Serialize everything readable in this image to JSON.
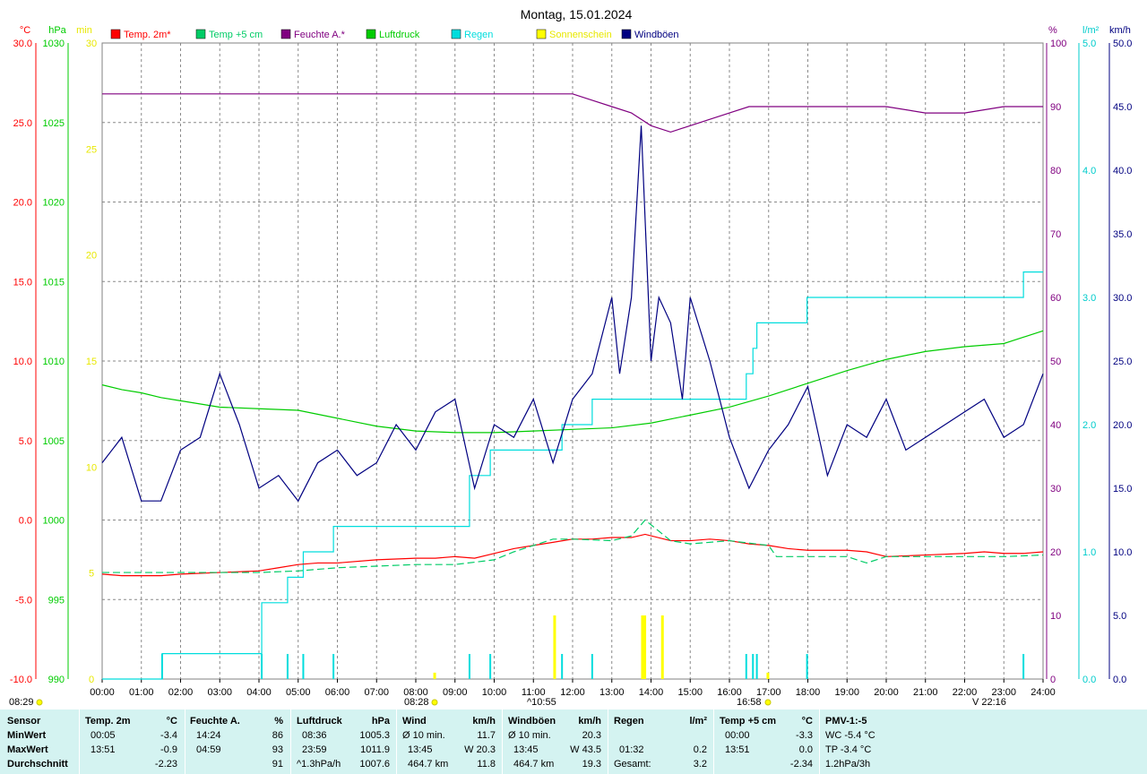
{
  "chart_data": {
    "type": "line",
    "title": "Montag, 15.01.2024",
    "x_ticks": [
      "00:00",
      "01:00",
      "02:00",
      "03:00",
      "04:00",
      "05:00",
      "06:00",
      "07:00",
      "08:00",
      "09:00",
      "10:00",
      "11:00",
      "12:00",
      "13:00",
      "14:00",
      "15:00",
      "16:00",
      "17:00",
      "18:00",
      "19:00",
      "20:00",
      "21:00",
      "22:00",
      "23:00",
      "24:00"
    ],
    "xlim": [
      0,
      24
    ],
    "grid": true,
    "legend_position": "top",
    "axes": {
      "temp": {
        "unit": "°C",
        "range": [
          -10,
          30
        ],
        "ticks": [
          "-10.0",
          "-5.0",
          "0.0",
          "5.0",
          "10.0",
          "15.0",
          "20.0",
          "25.0",
          "30.0"
        ],
        "color": "#ff0000"
      },
      "pressure": {
        "unit": "hPa",
        "range": [
          990,
          1030
        ],
        "ticks": [
          "990",
          "995",
          "1000",
          "1005",
          "1010",
          "1015",
          "1020",
          "1025",
          "1030"
        ],
        "color": "#00cc00"
      },
      "sunshine": {
        "unit": "min",
        "range": [
          0,
          30
        ],
        "ticks": [
          "0",
          "5",
          "10",
          "15",
          "20",
          "25",
          "30"
        ],
        "color": "#e8e800"
      },
      "humidity": {
        "unit": "%",
        "range": [
          0,
          100
        ],
        "ticks": [
          "0",
          "10",
          "20",
          "30",
          "40",
          "50",
          "60",
          "70",
          "80",
          "90",
          "100"
        ],
        "color": "#800080"
      },
      "rain": {
        "unit": "l/m²",
        "range": [
          0,
          5
        ],
        "ticks": [
          "0.0",
          "1.0",
          "2.0",
          "3.0",
          "4.0",
          "5.0"
        ],
        "color": "#00cccc"
      },
      "wind": {
        "unit": "km/h",
        "range": [
          0,
          50
        ],
        "ticks": [
          "0.0",
          "5.0",
          "10.0",
          "15.0",
          "20.0",
          "25.0",
          "30.0",
          "35.0",
          "40.0",
          "45.0",
          "50.0"
        ],
        "color": "#000080"
      }
    },
    "series": [
      {
        "name": "Temp. 2m*",
        "color": "#ff0000",
        "axis": "temp",
        "x": [
          0,
          0.5,
          1,
          1.5,
          2,
          3,
          4,
          4.5,
          5,
          5.5,
          6,
          7,
          8,
          8.5,
          9,
          9.5,
          10,
          10.5,
          11,
          11.5,
          12,
          12.5,
          13,
          13.5,
          13.85,
          14.5,
          15,
          15.5,
          16,
          16.5,
          17,
          17.5,
          18,
          19,
          19.5,
          20,
          21,
          22,
          22.5,
          23,
          23.5,
          24
        ],
        "y": [
          -3.4,
          -3.5,
          -3.5,
          -3.5,
          -3.4,
          -3.3,
          -3.2,
          -3.0,
          -2.8,
          -2.7,
          -2.7,
          -2.5,
          -2.4,
          -2.4,
          -2.3,
          -2.4,
          -2.1,
          -1.8,
          -1.6,
          -1.4,
          -1.2,
          -1.2,
          -1.1,
          -1.1,
          -0.9,
          -1.3,
          -1.3,
          -1.2,
          -1.3,
          -1.5,
          -1.6,
          -1.8,
          -1.9,
          -1.9,
          -2.0,
          -2.3,
          -2.2,
          -2.1,
          -2.0,
          -2.1,
          -2.1,
          -2.0
        ]
      },
      {
        "name": "Temp +5 cm",
        "color": "#00cc66",
        "dashed": true,
        "axis": "temp",
        "x": [
          0,
          2,
          4,
          5,
          6,
          7,
          8,
          9,
          10,
          10.5,
          11,
          11.5,
          12,
          13,
          13.5,
          13.85,
          14.5,
          15,
          16,
          17,
          17.2,
          18,
          19,
          19.5,
          20,
          21,
          22,
          23,
          24
        ],
        "y": [
          -3.3,
          -3.3,
          -3.3,
          -3.2,
          -3.0,
          -2.9,
          -2.8,
          -2.8,
          -2.5,
          -2.0,
          -1.6,
          -1.2,
          -1.2,
          -1.3,
          -1.0,
          0.0,
          -1.3,
          -1.5,
          -1.3,
          -1.6,
          -2.3,
          -2.3,
          -2.3,
          -2.7,
          -2.3,
          -2.3,
          -2.3,
          -2.3,
          -2.2
        ]
      },
      {
        "name": "Feuchte A.*",
        "color": "#800080",
        "axis": "humidity",
        "x": [
          0,
          1,
          2,
          3,
          4,
          5,
          6,
          7,
          8,
          9,
          10,
          11,
          12,
          12.5,
          13,
          13.5,
          14,
          14.5,
          15,
          15.5,
          16,
          16.5,
          17,
          18,
          19,
          20,
          21,
          22,
          23,
          24
        ],
        "y": [
          92,
          92,
          92,
          92,
          92,
          92,
          92,
          92,
          92,
          92,
          92,
          92,
          92,
          91,
          90,
          89,
          87,
          86,
          87,
          88,
          89,
          90,
          90,
          90,
          90,
          90,
          89,
          89,
          90,
          90
        ]
      },
      {
        "name": "Luftdruck",
        "color": "#00cc00",
        "axis": "pressure",
        "x": [
          0,
          0.5,
          1,
          1.5,
          2,
          3,
          4,
          5,
          6,
          7,
          8,
          9,
          10,
          11,
          12,
          13,
          14,
          15,
          16,
          17,
          18,
          19,
          20,
          21,
          22,
          23,
          24
        ],
        "y": [
          1008.5,
          1008.2,
          1008.0,
          1007.7,
          1007.5,
          1007.1,
          1007.0,
          1006.9,
          1006.4,
          1005.9,
          1005.6,
          1005.5,
          1005.5,
          1005.6,
          1005.7,
          1005.8,
          1006.1,
          1006.6,
          1007.1,
          1007.8,
          1008.6,
          1009.4,
          1010.1,
          1010.6,
          1010.9,
          1011.1,
          1011.9
        ]
      },
      {
        "name": "Regen",
        "color": "#00dddd",
        "axis": "rain",
        "type": "step",
        "x": [
          0,
          1.53,
          4.07,
          4.73,
          5.13,
          5.9,
          6.87,
          8.0,
          9.37,
          9.9,
          11.73,
          12.03,
          12.5,
          15.98,
          16.3,
          16.43,
          16.6,
          16.7,
          17.98,
          18.0,
          20.0,
          22.0,
          23.5,
          23.95,
          24
        ],
        "y": [
          0,
          0.2,
          0.6,
          0.8,
          1.0,
          1.2,
          1.2,
          1.2,
          1.6,
          1.8,
          2.0,
          2.0,
          2.2,
          2.2,
          2.2,
          2.4,
          2.6,
          2.8,
          3.0,
          3.0,
          3.0,
          3.0,
          3.2,
          3.2,
          3.2
        ]
      },
      {
        "name": "Sonnenschein",
        "color": "#ffff00",
        "axis": "sunshine",
        "type": "bars",
        "x": [
          8.47,
          11.53,
          13.77,
          13.83,
          14.28,
          16.97
        ],
        "y": [
          0.3,
          3.0,
          3.0,
          3.0,
          3.0,
          0.3
        ]
      },
      {
        "name": "Windböen",
        "color": "#000080",
        "axis": "wind",
        "x": [
          0,
          0.5,
          1,
          1.5,
          2,
          2.5,
          3,
          3.5,
          4,
          4.5,
          5,
          5.5,
          6,
          6.5,
          7,
          7.5,
          8,
          8.5,
          9,
          9.5,
          10,
          10.5,
          11,
          11.5,
          12,
          12.5,
          13,
          13.2,
          13.5,
          13.75,
          14,
          14.2,
          14.5,
          14.8,
          15,
          15.5,
          16,
          16.5,
          17,
          17.5,
          18,
          18.5,
          19,
          19.5,
          20,
          20.5,
          21,
          21.5,
          22,
          22.5,
          23,
          23.5,
          24
        ],
        "y": [
          17,
          19,
          14,
          14,
          18,
          19,
          24,
          20,
          15,
          16,
          14,
          17,
          18,
          16,
          17,
          20,
          18,
          21,
          22,
          15,
          20,
          19,
          22,
          17,
          22,
          24,
          30,
          24,
          30,
          43.5,
          25,
          30,
          28,
          22,
          30,
          25,
          19,
          15,
          18,
          20,
          23,
          16,
          20,
          19,
          22,
          18,
          19,
          20,
          21,
          22,
          19,
          20,
          24
        ]
      }
    ],
    "markers": {
      "daylight_start": "08:29",
      "daylight_end": "16:58",
      "sunrise": "08:28",
      "sun_high": "^10:55",
      "sunset_mark": "V 22:16"
    },
    "legend": [
      {
        "label": "Temp. 2m*",
        "color": "#ff0000"
      },
      {
        "label": "Temp +5 cm",
        "color": "#00cc66"
      },
      {
        "label": "Feuchte A.*",
        "color": "#800080"
      },
      {
        "label": "Luftdruck",
        "color": "#00cc00"
      },
      {
        "label": "Regen",
        "color": "#00dddd"
      },
      {
        "label": "Sonnenschein",
        "color": "#ffff00"
      },
      {
        "label": "Windböen",
        "color": "#000080"
      }
    ]
  },
  "stats": {
    "row_labels": [
      "Sensor",
      "MinWert",
      "MaxWert",
      "Durchschnitt"
    ],
    "temp2m": {
      "header": "Temp. 2m",
      "unit": "°C",
      "min_time": "00:05",
      "min": "-3.4",
      "max_time": "13:51",
      "max": "-0.9",
      "avg": "-2.23"
    },
    "humidity": {
      "header": "Feuchte A.",
      "unit": "%",
      "min_time": "14:24",
      "min": "86",
      "max_time": "04:59",
      "max": "93",
      "avg": "91"
    },
    "pressure": {
      "header": "Luftdruck",
      "unit": "hPa",
      "min_time": "08:36",
      "min": "1005.3",
      "max_time": "23:59",
      "max": "1011.9",
      "avg_label": "^1.3hPa/h",
      "avg": "1007.6"
    },
    "wind": {
      "header": "Wind",
      "unit": "km/h",
      "min_label": "Ø 10 min.",
      "min": "11.7",
      "max_time": "13:45",
      "max_label": "W 20.3",
      "dist": "464.7 km",
      "avg": "11.8"
    },
    "gusts": {
      "header": "Windböen",
      "unit": "km/h",
      "min_label": "Ø 10 min.",
      "min": "20.3",
      "max_time": "13:45",
      "max_label": "W 43.5",
      "dist": "464.7 km",
      "avg": "19.3"
    },
    "rain": {
      "header": "Regen",
      "unit": "l/m²",
      "max_time": "01:32",
      "max": "0.2",
      "total_label": "Gesamt:",
      "total": "3.2"
    },
    "temp5cm": {
      "header": "Temp +5 cm",
      "unit": "°C",
      "min_time": "00:00",
      "min": "-3.3",
      "max_time": "13:51",
      "max": "0.0",
      "avg": "-2.34"
    },
    "pmv": {
      "header": "PMV-1:-5",
      "wc": "WC -5.4 °C",
      "tp": "TP -3.4 °C",
      "trend": "1.2hPa/3h"
    }
  }
}
